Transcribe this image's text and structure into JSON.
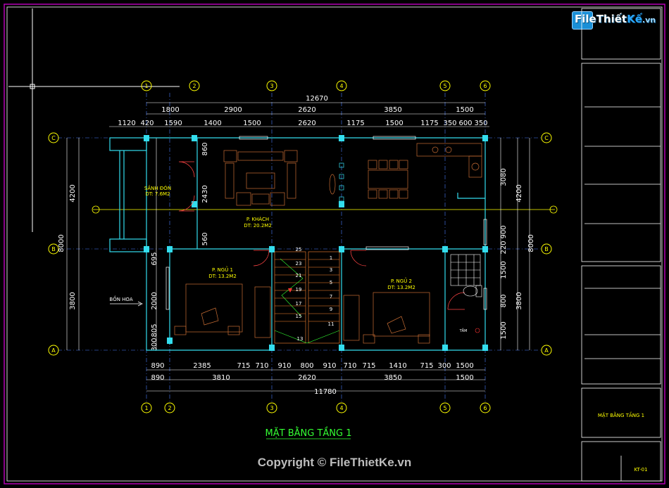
{
  "branding": {
    "logo_main": "FileThiết",
    "logo_suffix": "Kế",
    "logo_domain": ".vn"
  },
  "copyright": "Copyright © FileThietKe.vn",
  "drawing_title": "MẶT BẰNG TẦNG 1",
  "title_block": {
    "sheet_name": "MẶT BẰNG TẦNG 1",
    "sheet_no": "KT-01"
  },
  "grid_axes": {
    "columns": [
      "1",
      "2",
      "3",
      "4",
      "5",
      "6"
    ],
    "rows": [
      "A",
      "B",
      "C"
    ]
  },
  "dimensions": {
    "top_total": "12670",
    "top_row1": [
      "1800",
      "2900",
      "2620",
      "3850",
      "1500"
    ],
    "top_row2": [
      "1120",
      "420",
      "1590",
      "1400",
      "1500",
      "2620",
      "1175",
      "1500",
      "1175",
      "350",
      "600",
      "350"
    ],
    "bottom_row1": [
      "890",
      "2385",
      "715",
      "710",
      "910",
      "800",
      "910",
      "710",
      "715",
      "1410",
      "715",
      "300",
      "1500"
    ],
    "bottom_row2": [
      "890",
      "3810",
      "2620",
      "3850",
      "1500"
    ],
    "bottom_total": "11780",
    "left_outer": [
      "4200",
      "3800"
    ],
    "left_total": "8000",
    "left_inner": [
      "860",
      "2430",
      "560",
      "695",
      "2000",
      "805",
      "300"
    ],
    "right_inner": [
      "3080",
      "900",
      "220",
      "1500",
      "800",
      "1500"
    ],
    "right_outer": [
      "4200",
      "3800"
    ],
    "right_total": "8000"
  },
  "rooms": [
    {
      "name": "SẢNH ĐÓN",
      "area": "DT: 7.6M2"
    },
    {
      "name": "P. KHÁCH",
      "area": "DT: 20.2M2"
    },
    {
      "name": "P. NGỦ 1",
      "area": "DT: 13.2M2"
    },
    {
      "name": "P. NGỦ 2",
      "area": "DT: 13.2M2"
    }
  ],
  "labels": {
    "flower_box": "BỒN HOA",
    "shower": "TẮM"
  },
  "stair_steps": [
    "25",
    "23",
    "21",
    "19",
    "17",
    "15",
    "13",
    "11",
    "9",
    "7",
    "5",
    "3",
    "1"
  ]
}
